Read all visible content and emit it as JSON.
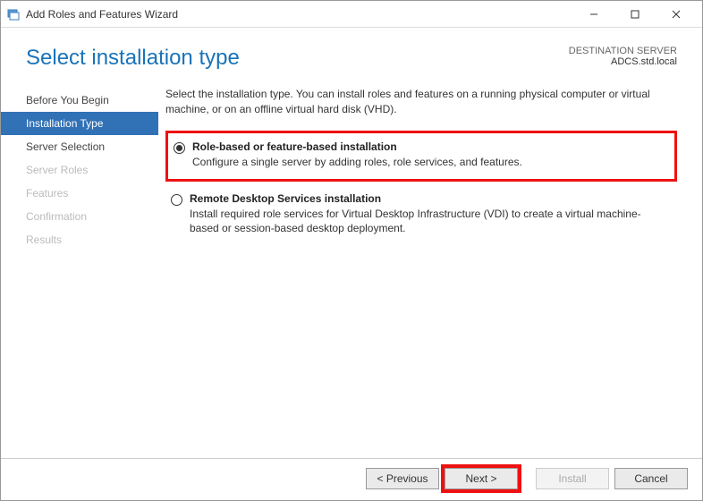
{
  "window": {
    "title": "Add Roles and Features Wizard"
  },
  "header": {
    "page_title": "Select installation type",
    "destination_label": "DESTINATION SERVER",
    "destination_value": "ADCS.std.local"
  },
  "sidebar": {
    "items": [
      {
        "label": "Before You Begin",
        "active": false,
        "disabled": false
      },
      {
        "label": "Installation Type",
        "active": true,
        "disabled": false
      },
      {
        "label": "Server Selection",
        "active": false,
        "disabled": false
      },
      {
        "label": "Server Roles",
        "active": false,
        "disabled": true
      },
      {
        "label": "Features",
        "active": false,
        "disabled": true
      },
      {
        "label": "Confirmation",
        "active": false,
        "disabled": true
      },
      {
        "label": "Results",
        "active": false,
        "disabled": true
      }
    ]
  },
  "content": {
    "intro": "Select the installation type. You can install roles and features on a running physical computer or virtual machine, or on an offline virtual hard disk (VHD).",
    "options": [
      {
        "title": "Role-based or feature-based installation",
        "desc": "Configure a single server by adding roles, role services, and features.",
        "selected": true,
        "highlighted": true
      },
      {
        "title": "Remote Desktop Services installation",
        "desc": "Install required role services for Virtual Desktop Infrastructure (VDI) to create a virtual machine-based or session-based desktop deployment.",
        "selected": false,
        "highlighted": false
      }
    ]
  },
  "footer": {
    "previous": "< Previous",
    "next": "Next >",
    "install": "Install",
    "cancel": "Cancel"
  }
}
